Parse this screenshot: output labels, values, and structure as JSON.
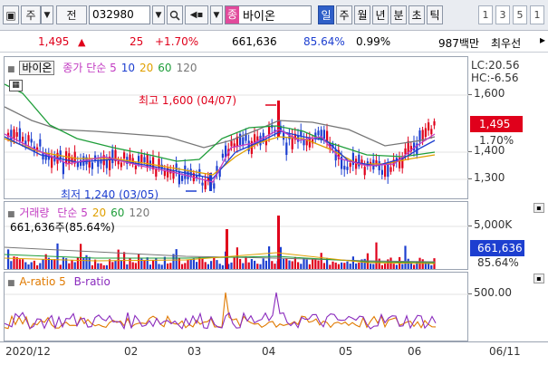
{
  "toolbar": {
    "type_selector": "주",
    "code_label": "전",
    "stock_code": "032980",
    "stock_name_tag": "종",
    "stock_name": "바이온",
    "timeframes": [
      "일",
      "주",
      "월",
      "년",
      "분",
      "초",
      "틱"
    ],
    "active_timeframe": "일",
    "intervals": [
      "1",
      "3",
      "5",
      "1"
    ]
  },
  "quote": {
    "price": "1,495",
    "change": "25",
    "change_pct": "+1.70%",
    "volume": "661,636",
    "vol_ratio": "85.64%",
    "turnover_rate": "0.99%",
    "amount": "987백만",
    "broker": "최우선"
  },
  "price_panel": {
    "legend_stock": "바이온",
    "legend_items": [
      {
        "label": "종가 단순 5",
        "color": "#c23bc2"
      },
      {
        "label": "10",
        "color": "#1d3fd0"
      },
      {
        "label": "20",
        "color": "#e0a000"
      },
      {
        "label": "60",
        "color": "#1f9e3a"
      },
      {
        "label": "120",
        "color": "#777777"
      }
    ],
    "lc": "LC:20.56",
    "hc": "HC:-6.56",
    "y_ticks": [
      "1,600",
      "1,400",
      "1,300"
    ],
    "current_price_tag": "1,495",
    "current_change_tag": "1.70%",
    "high_annotation": "최고 1,600 (04/07)",
    "low_annotation": "최저 1,240 (03/05)"
  },
  "volume_panel": {
    "title": "거래량",
    "legend_items": [
      {
        "label": "단순 5",
        "color": "#c23bc2"
      },
      {
        "label": "20",
        "color": "#e0a000"
      },
      {
        "label": "60",
        "color": "#1f9e3a"
      },
      {
        "label": "120",
        "color": "#777777"
      }
    ],
    "subtitle": "661,636주(85.64%)",
    "y_tick": "5,000K",
    "current_tag": "661,636",
    "current_pct": "85.64%"
  },
  "ratio_panel": {
    "legend_a": "A-ratio 5",
    "legend_b": "B-ratio",
    "y_tick": "500.00"
  },
  "x_axis": {
    "labels": [
      "2020/12",
      "02",
      "03",
      "04",
      "05",
      "06"
    ],
    "current_date": "06/11"
  },
  "colors": {
    "up": "#e0001b",
    "down": "#1d3fd0",
    "ma5": "#c23bc2",
    "ma10": "#1d3fd0",
    "ma20": "#e0a000",
    "ma60": "#1f9e3a",
    "ma120": "#777777"
  }
}
